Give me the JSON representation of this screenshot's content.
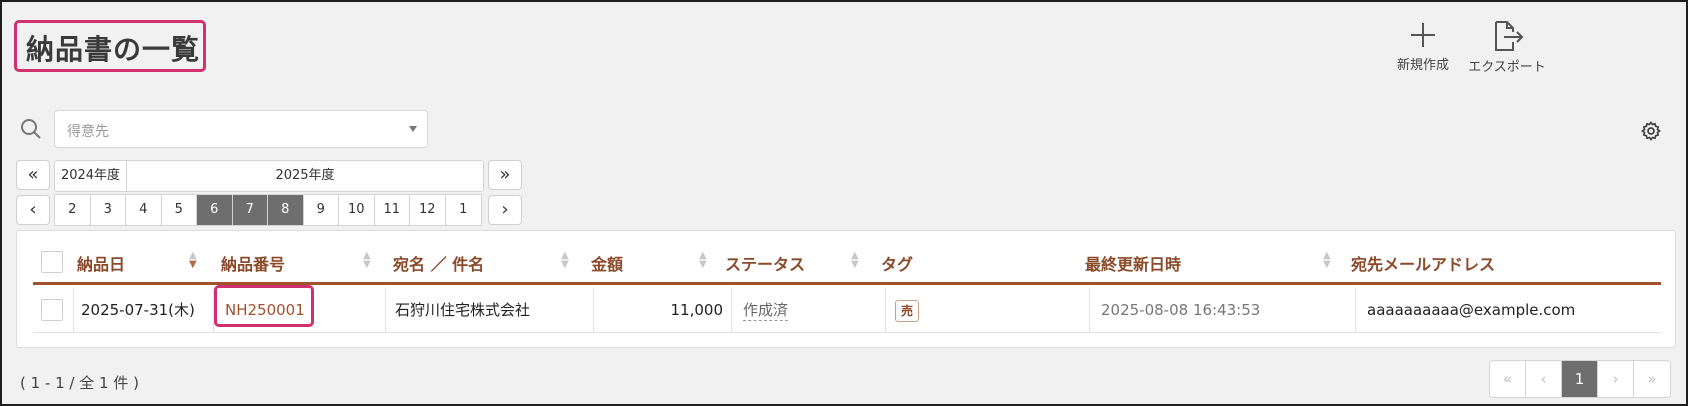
{
  "page_title": "納品書の一覧",
  "header_actions": {
    "new_label": "新規作成",
    "export_label": "エクスポート"
  },
  "search": {
    "placeholder": "得意先"
  },
  "year_nav": {
    "prev_year": "2024年度",
    "current_year": "2025年度"
  },
  "months": [
    "2",
    "3",
    "4",
    "5",
    "6",
    "7",
    "8",
    "9",
    "10",
    "11",
    "12",
    "1"
  ],
  "selected_months": [
    "6",
    "7",
    "8"
  ],
  "table": {
    "columns": [
      "納品日",
      "納品番号",
      "宛名 ／ 件名",
      "金額",
      "ステータス",
      "タグ",
      "最終更新日時",
      "宛先メールアドレス"
    ],
    "rows": [
      {
        "date": "2025-07-31(木)",
        "number": "NH250001",
        "recipient": "石狩川住宅株式会社",
        "amount": "11,000",
        "status": "作成済",
        "tag": "売",
        "updated": "2025-08-08 16:43:53",
        "email": "aaaaaaaaaa@example.com"
      }
    ]
  },
  "footer": {
    "count_text": "( 1 - 1 / 全 1 件 )"
  },
  "pagination": {
    "first": "«",
    "prev": "‹",
    "current": "1",
    "next": "›",
    "last": "»"
  },
  "colors": {
    "accent": "#a0522d",
    "highlight": "#d0306e",
    "selected_month": "#6e6e6e"
  },
  "icons": [
    "search-icon",
    "plus-icon",
    "export-icon",
    "gear-icon",
    "double-chevron-left-icon",
    "chevron-left-icon",
    "double-chevron-right-icon",
    "chevron-right-icon",
    "sort-icon"
  ]
}
